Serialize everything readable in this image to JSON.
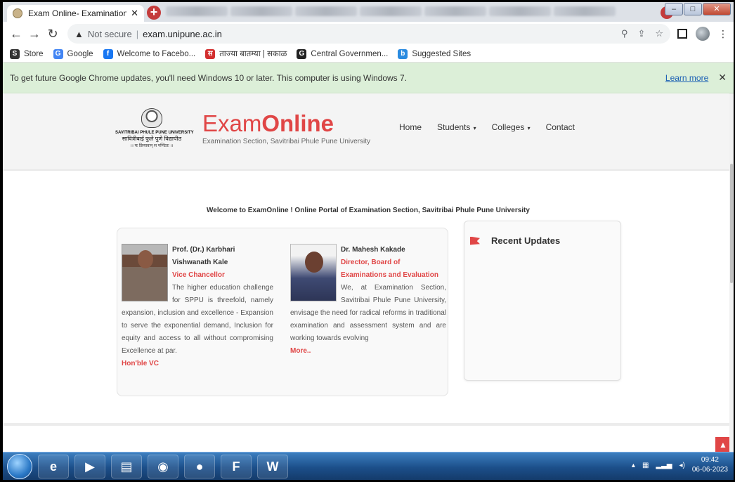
{
  "browser": {
    "tab_title": "Exam Online- Examination Sectio",
    "tab_close": "✕",
    "new_tab": "+",
    "security_label": "Not secure",
    "url": "exam.unipune.ac.in",
    "bookmarks": [
      {
        "label": "Store",
        "color": "#333333",
        "icon": "S"
      },
      {
        "label": "Google",
        "color": "#4285f4",
        "icon": "G"
      },
      {
        "label": "Welcome to Facebo...",
        "color": "#1877f2",
        "icon": "f"
      },
      {
        "label": "ताज्या बातम्या | सकाळ",
        "color": "#d32f2f",
        "icon": "स"
      },
      {
        "label": "Central Governmen...",
        "color": "#222222",
        "icon": "G"
      },
      {
        "label": "Suggested Sites",
        "color": "#2a8be0",
        "icon": "b"
      }
    ],
    "infobar_text": "To get future Google Chrome updates, you'll need Windows 10 or later. This computer is using Windows 7.",
    "infobar_link": "Learn more",
    "infobar_close": "✕"
  },
  "site": {
    "logo_line1": "SAVITRIBAI PHULE PUNE UNIVERSITY",
    "logo_line2": "सावित्रीबाई फुले पुणे विद्यापीठ",
    "logo_line3": "।। यः क्रियावान् स पण्डितः ।।",
    "brand_exam": "Exam",
    "brand_online": "Online",
    "brand_sub": "Examination Section, Savitribai Phule Pune University",
    "nav": [
      {
        "label": "Home",
        "dropdown": false
      },
      {
        "label": "Students",
        "dropdown": true
      },
      {
        "label": "Colleges",
        "dropdown": true
      },
      {
        "label": "Contact",
        "dropdown": false
      }
    ],
    "welcome": "Welcome to ExamOnline ! Online Portal of Examination Section, Savitribai Phule Pune University",
    "vc": {
      "name": "Prof. (Dr.) Karbhari Vishwanath Kale",
      "role": "Vice Chancellor",
      "body": "The higher education challenge for SPPU is threefold, namely expansion, inclusion and excellence - Expansion to serve the exponential demand, Inclusion for equity and access to all without compromising Excellence at par.",
      "link": "Hon'ble VC"
    },
    "director": {
      "name": "Dr. Mahesh Kakade",
      "role": "Director, Board of Examinations and Evaluation",
      "body": "We, at Examination Section, Savitribai Phule Pune University, envisage the need for radical reforms in traditional examination and assessment system and are working towards evolving",
      "link": "More.."
    },
    "updates_title": "Recent Updates",
    "accent": "#e04646"
  },
  "taskbar": {
    "time": "09:42",
    "date": "06-06-2023"
  }
}
